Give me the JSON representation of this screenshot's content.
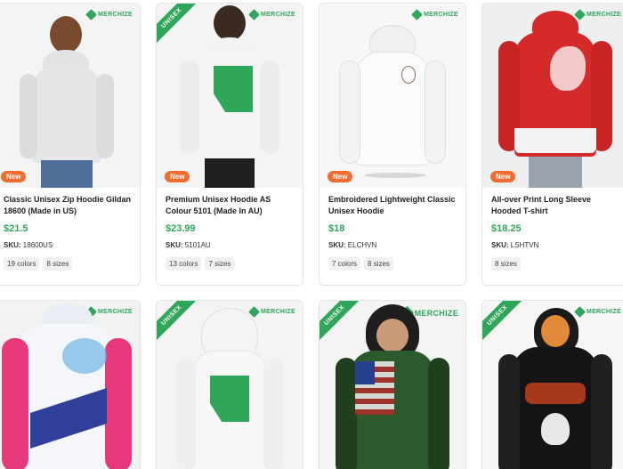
{
  "brand": {
    "name": "MERCHIZE",
    "color": "#2fa65a"
  },
  "badges": {
    "new": "New",
    "unisex": "UNISEX"
  },
  "sku_label": "SKU:",
  "products": [
    {
      "title": "Classic Unisex Zip Hoodie Gildan 18600 (Made in US)",
      "price": "$21.5",
      "sku": "18600US",
      "colors": "19 colors",
      "sizes": "8 sizes"
    },
    {
      "title": "Premium Unisex Hoodie AS Colour 5101 (Made In AU)",
      "price": "$23.99",
      "sku": "5101AU",
      "colors": "13 colors",
      "sizes": "7 sizes"
    },
    {
      "title": "Embroidered Lightweight Classic Unisex Hoodie",
      "price": "$18",
      "sku": "ELCHVN",
      "colors": "7 colors",
      "sizes": "8 sizes"
    },
    {
      "title": "All-over Print Long Sleeve Hooded T-shirt",
      "price": "$18.25",
      "sku": "LSHTVN",
      "colors": "",
      "sizes": "8 sizes"
    }
  ]
}
